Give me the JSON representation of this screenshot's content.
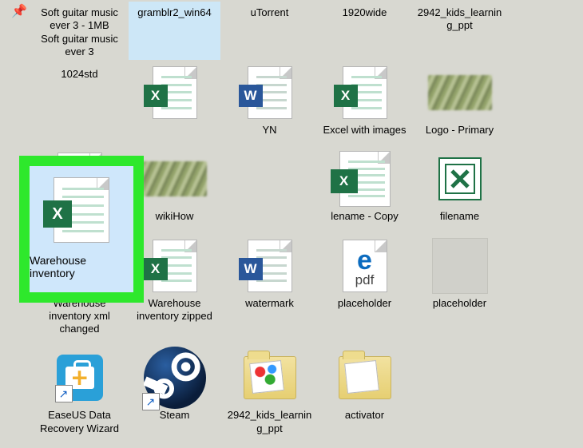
{
  "row1": [
    {
      "label": "Soft guitar music ever 3 - 1MB\nSoft guitar music ever 3",
      "selected": false
    },
    {
      "label": "gramblr2_win64",
      "selected": true
    },
    {
      "label": "uTorrent",
      "selected": false
    },
    {
      "label": "1920wide",
      "selected": false
    },
    {
      "label": "2942_kids_learning_ppt",
      "selected": false
    },
    {
      "label": "1024std",
      "selected": false
    }
  ],
  "row2": [
    {
      "label": "",
      "icon": "excel"
    },
    {
      "label": "YN",
      "icon": "word"
    },
    {
      "label": "Excel with images",
      "icon": "excel"
    },
    {
      "label": "Logo - Primary",
      "icon": "blur"
    },
    {
      "label": "Logo - Primary",
      "icon": "edge-pdf"
    },
    {
      "label": "wikiHow",
      "icon": "blur"
    }
  ],
  "highlight": {
    "label": "Warehouse inventory",
    "icon": "excel"
  },
  "row3": [
    {
      "label": "lename - Copy",
      "icon": "excel-doc-big"
    },
    {
      "label": "filename",
      "icon": "excel-legacy"
    },
    {
      "label": "Warehouse inventory xml changed",
      "icon": "excel"
    },
    {
      "label": "Warehouse inventory zipped",
      "icon": "excel"
    },
    {
      "label": "watermark",
      "icon": "word"
    }
  ],
  "row4": [
    {
      "label": "placeholder",
      "icon": "edge-pdf"
    },
    {
      "label": "placeholder",
      "icon": "blank"
    },
    {
      "label": "EaseUS Data Recovery Wizard",
      "icon": "easeus",
      "shortcut": true
    },
    {
      "label": "Steam",
      "icon": "steam",
      "shortcut": true
    },
    {
      "label": "2942_kids_learning_ppt",
      "icon": "folder-pics"
    },
    {
      "label": "activator",
      "icon": "folder-plain"
    }
  ],
  "pdf_label": "pdf"
}
